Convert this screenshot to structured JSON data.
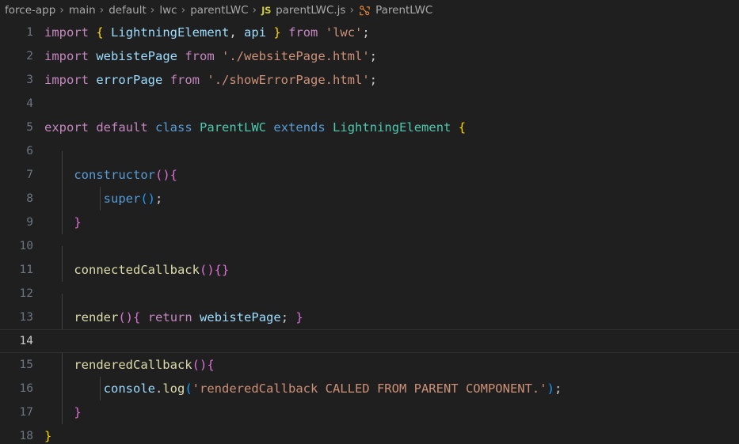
{
  "breadcrumb": {
    "items": [
      {
        "label": "force-app",
        "icon": null
      },
      {
        "label": "main",
        "icon": null
      },
      {
        "label": "default",
        "icon": null
      },
      {
        "label": "lwc",
        "icon": null
      },
      {
        "label": "parentLWC",
        "icon": null
      },
      {
        "label": "parentLWC.js",
        "icon": "js-file-icon"
      },
      {
        "label": "ParentLWC",
        "icon": "class-symbol-icon"
      }
    ],
    "separator": "›",
    "js_badge_text": "JS"
  },
  "editor": {
    "language": "javascript",
    "file_name": "parentLWC.js",
    "active_line": 14,
    "first_visible_line": 1,
    "last_visible_line": 18,
    "lines": [
      {
        "n": "1",
        "text": "import { LightningElement, api } from 'lwc';"
      },
      {
        "n": "2",
        "text": "import webistePage from './websitePage.html';"
      },
      {
        "n": "3",
        "text": "import errorPage from './showErrorPage.html';"
      },
      {
        "n": "4",
        "text": ""
      },
      {
        "n": "5",
        "text": "export default class ParentLWC extends LightningElement {"
      },
      {
        "n": "6",
        "text": ""
      },
      {
        "n": "7",
        "text": "    constructor(){"
      },
      {
        "n": "8",
        "text": "        super();"
      },
      {
        "n": "9",
        "text": "    }"
      },
      {
        "n": "10",
        "text": ""
      },
      {
        "n": "11",
        "text": "    connectedCallback(){}"
      },
      {
        "n": "12",
        "text": ""
      },
      {
        "n": "13",
        "text": "    render(){ return webistePage; }"
      },
      {
        "n": "14",
        "text": ""
      },
      {
        "n": "15",
        "text": "    renderedCallback(){"
      },
      {
        "n": "16",
        "text": "        console.log('renderedCallback CALLED FROM PARENT COMPONENT.');"
      },
      {
        "n": "17",
        "text": "    }"
      },
      {
        "n": "18",
        "text": "}"
      }
    ]
  },
  "colors": {
    "background": "#1f1f1f",
    "foreground": "#cccccc",
    "line_number": "#6e7681",
    "line_number_active": "#cccccc",
    "active_line_border": "#2f2f2f",
    "indent_guide": "#404040",
    "keyword": "#c586c0",
    "control": "#569cd6",
    "variable": "#9cdcfe",
    "class_name": "#4ec9b0",
    "function_name": "#dcdcaa",
    "string": "#ce9178",
    "bracket_1": "#ffd700",
    "bracket_2": "#da70d6",
    "bracket_3": "#179fff",
    "breadcrumb_text": "#a9a9a9",
    "js_badge": "#cbcb41",
    "class_icon": "#e8883a"
  }
}
